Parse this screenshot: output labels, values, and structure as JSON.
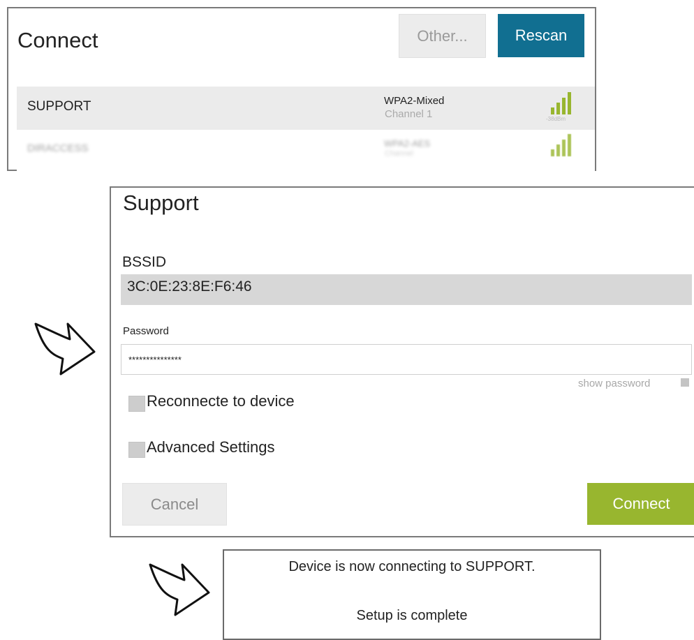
{
  "connect_panel": {
    "title": "Connect",
    "other_button": "Other...",
    "rescan_button": "Rescan",
    "networks": [
      {
        "name": "SUPPORT",
        "security": "WPA2-Mixed",
        "channel": "Channel 1",
        "signal": "-38dBm",
        "signal_level": 4,
        "selected": true
      },
      {
        "name": "DIRACCESS",
        "security": "WPA2-AES",
        "channel": "Channel",
        "signal": "",
        "signal_level": 4,
        "selected": false
      }
    ],
    "signal_color": "#98b62f",
    "rescan_color": "#116f91"
  },
  "support_panel": {
    "title": "Support",
    "bssid_label": "BSSID",
    "bssid_value": "3C:0E:23:8E:F6:46",
    "password_label": "Password",
    "password_value": "***************",
    "show_password_label": "show password",
    "reconnect_label": "Reconnecte to device",
    "advanced_label": "Advanced Settings",
    "cancel_button": "Cancel",
    "connect_button": "Connect",
    "connect_color": "#98b62f"
  },
  "status_panel": {
    "line1": "Device is now connecting to SUPPORT.",
    "line2": "Setup is complete"
  },
  "icons": [
    "signal-bars-icon",
    "arrow-right-icon"
  ]
}
